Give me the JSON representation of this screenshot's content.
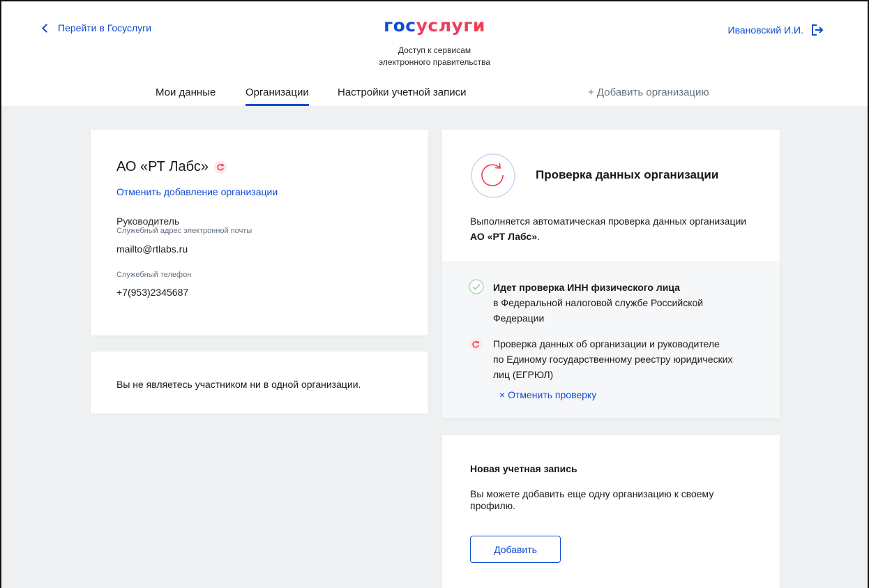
{
  "header": {
    "back_label": "Перейти в Госуслуги",
    "logo_part1": "гос",
    "logo_part2": "услуги",
    "tagline_line1": "Доступ к сервисам",
    "tagline_line2": "электронного правительства",
    "user_name": "Ивановский И.И."
  },
  "tabs": [
    {
      "label": "Мои данные"
    },
    {
      "label": "Организации"
    },
    {
      "label": "Настройки учетной записи"
    },
    {
      "label": "+ Добавить организацию"
    }
  ],
  "org_card": {
    "name": "АО «РТ Лабс»",
    "cancel_link": "Отменить добавление организации",
    "role": "Руководитель",
    "email_label": "Служебный адрес электронной почты",
    "email_value": "mailto@rtlabs.ru",
    "phone_label": "Служебный телефон",
    "phone_value": "+7(953)2345687"
  },
  "membership_card": {
    "text": "Вы не являетесь участником ни в одной организации."
  },
  "check_card": {
    "title": "Проверка данных организации",
    "desc_prefix": "Выполняется автоматическая проверка данных организации",
    "desc_org": "АО «РТ Лабс»",
    "desc_suffix": ".",
    "steps": [
      {
        "status": "done",
        "title": "Идет проверка ИНН физического лица",
        "line2": "в Федеральной налоговой службе Российской",
        "line3": "Федерации"
      },
      {
        "status": "in-progress",
        "line1": "Проверка данных об организации и руководителе",
        "line2": "по Единому государственному реестру юридических",
        "line3": "лиц (ЕГРЮЛ)"
      }
    ],
    "cancel_check": "× Отменить проверку"
  },
  "new_account_card": {
    "title": "Новая учетная запись",
    "line1": "Вы можете добавить еще одну организацию к своему",
    "line2": "профилю.",
    "button": "Добавить"
  },
  "colors": {
    "accent": "#0d4cd3",
    "brand_red": "#ee3f58",
    "success": "#7fcf8a",
    "background": "#eef0f1"
  }
}
